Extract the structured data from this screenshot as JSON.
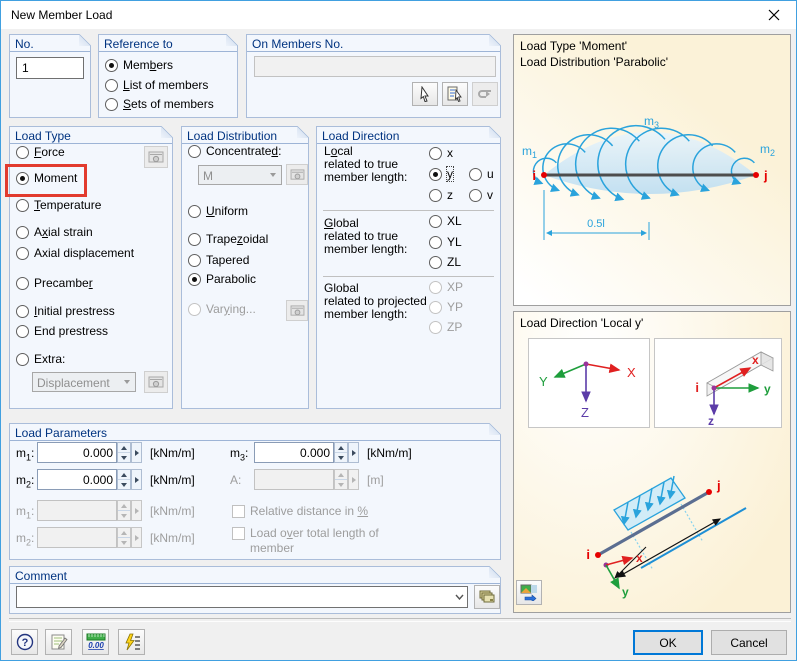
{
  "window": {
    "title": "New Member Load"
  },
  "colors": {
    "accent_border": "#41a0e0",
    "group_title": "#003380",
    "diagram_blue": "#2aa3dc",
    "highlight_red": "#e23b2e",
    "node_red": "#e60000",
    "axis_x_red": "#e02020",
    "axis_y_green": "#1e9e3c",
    "axis_z_purple": "#5c3ca8",
    "panel_cream": "#fbf1d6"
  },
  "no_group": {
    "title": "No.",
    "value": "1"
  },
  "reference": {
    "title": "Reference to",
    "members": {
      "pre": "Mem",
      "key": "b",
      "post": "ers"
    },
    "list": {
      "pre": "",
      "key": "L",
      "post": "ist of members"
    },
    "sets": {
      "pre": "",
      "key": "S",
      "post": "ets of members"
    }
  },
  "on_members": {
    "title": "On Members No.",
    "value": ""
  },
  "load_type": {
    "title": "Load Type",
    "force": {
      "pre": "",
      "key": "F",
      "post": "orce"
    },
    "moment": {
      "pre": "Moment",
      "key": "",
      "post": ""
    },
    "temperature": {
      "pre": "",
      "key": "T",
      "post": "emperature"
    },
    "axial_strain": {
      "pre": "A",
      "key": "x",
      "post": "ial strain"
    },
    "axial_displacement": {
      "pre": "Axial displacement",
      "key": "",
      "post": ""
    },
    "precamber": {
      "pre": "Precambe",
      "key": "r",
      "post": ""
    },
    "initial_prestress": {
      "pre": "",
      "key": "I",
      "post": "nitial prestress"
    },
    "end_prestress": {
      "pre": "End prestress",
      "key": "",
      "post": ""
    },
    "extra": {
      "pre": "Extra:",
      "key": "",
      "post": ""
    },
    "extra_value": "Displacement"
  },
  "load_distribution": {
    "title": "Load Distribution",
    "concentrated": {
      "pre": "Concentrate",
      "key": "d",
      "post": ":"
    },
    "concentrated_value": "M",
    "uniform": {
      "pre": "",
      "key": "U",
      "post": "niform"
    },
    "trapezoidal": {
      "pre": "Trape",
      "key": "z",
      "post": "oidal"
    },
    "tapered": {
      "pre": "Tapered",
      "key": "",
      "post": ""
    },
    "parabolic": {
      "pre": "Parabolic",
      "key": "",
      "post": ""
    },
    "varying": {
      "pre": "Var",
      "key": "y",
      "post": "ing..."
    }
  },
  "load_direction": {
    "title": "Load Direction",
    "local": {
      "l1pre": "L",
      "l1key": "o",
      "l1post": "cal",
      "l2": "related to true",
      "l3": "member length:"
    },
    "global_true": {
      "l1pre": "",
      "l1key": "G",
      "l1post": "lobal",
      "l2": "related to true",
      "l3": "member length:"
    },
    "global_proj": {
      "l1": "Global",
      "l2pre": "related to pro",
      "l2key": "j",
      "l2post": "ected",
      "l3": "member length:"
    },
    "opts": {
      "x": "x",
      "y": "y",
      "z": "z",
      "u": "u",
      "v": "v",
      "XL": "XL",
      "YL": "YL",
      "ZL": "ZL",
      "XP": "XP",
      "YP": "YP",
      "ZP": "ZP"
    }
  },
  "load_parameters": {
    "title": "Load Parameters",
    "m1": {
      "base": "m",
      "sub": "1",
      "post": ":",
      "value": "0.000",
      "unit": "[kNm/m]"
    },
    "m2": {
      "base": "m",
      "sub": "2",
      "post": ":",
      "value": "0.000",
      "unit": "[kNm/m]"
    },
    "m3": {
      "base": "m",
      "sub": "3",
      "post": ":",
      "value": "0.000",
      "unit": "[kNm/m]"
    },
    "a": {
      "base": "A",
      "sub": "",
      "post": ":",
      "value": "",
      "unit": "[m]"
    },
    "m1d": {
      "base": "m",
      "sub": "1",
      "post": ":",
      "value": "",
      "unit": "[kNm/m]"
    },
    "m2d": {
      "base": "m",
      "sub": "2",
      "post": ":",
      "value": "",
      "unit": "[kNm/m]"
    },
    "relative_cb": {
      "pre": "Relative distance in ",
      "key": "%",
      "post": ""
    },
    "total_cb": {
      "pre": "Load o",
      "key": "v",
      "post": "er total length of",
      "line2": "member"
    }
  },
  "comment": {
    "title": "Comment",
    "value": ""
  },
  "panel_top": {
    "title1": "Load Type 'Moment'",
    "title2": "Load Distribution 'Parabolic'",
    "m_base": "m",
    "m1_sub": "1",
    "m2_sub": "2",
    "m3_sub": "3",
    "i": "i",
    "j": "j",
    "dim": "0.5l"
  },
  "panel_mid": {
    "title": "Load Direction 'Local y'",
    "global_axes": {
      "X": "X",
      "Y": "Y",
      "Z": "Z"
    },
    "local_axes": {
      "x": "x",
      "y": "y",
      "z": "z",
      "i": "i"
    },
    "scheme": {
      "i": "i",
      "j": "j",
      "x": "x",
      "y": "y"
    }
  },
  "footer": {
    "ok": "OK",
    "cancel": "Cancel"
  }
}
